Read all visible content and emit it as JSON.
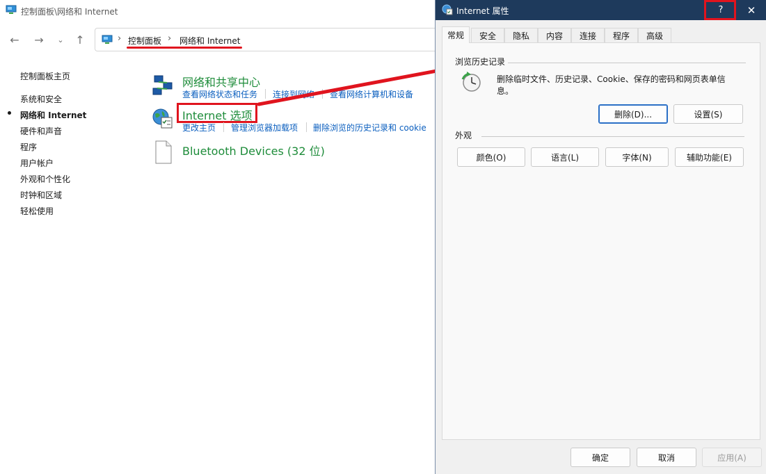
{
  "control_panel": {
    "window_title": "控制面板\\网络和 Internet",
    "breadcrumb": [
      "控制面板",
      "网络和 Internet"
    ],
    "sidebar": {
      "items": [
        {
          "label": "控制面板主页"
        },
        {
          "label": "系统和安全"
        },
        {
          "label": "网络和 Internet",
          "active": true
        },
        {
          "label": "硬件和声音"
        },
        {
          "label": "程序"
        },
        {
          "label": "用户帐户"
        },
        {
          "label": "外观和个性化"
        },
        {
          "label": "时钟和区域"
        },
        {
          "label": "轻松使用"
        }
      ]
    },
    "categories": [
      {
        "title": "网络和共享中心",
        "icon": "network-center-icon",
        "links": [
          "查看网络状态和任务",
          "连接到网络",
          "查看网络计算机和设备"
        ]
      },
      {
        "title": "Internet 选项",
        "icon": "internet-options-icon",
        "links": [
          "更改主页",
          "管理浏览器加载项",
          "删除浏览的历史记录和 cookie"
        ]
      },
      {
        "title": "Bluetooth Devices (32 位)",
        "icon": "blank-document-icon",
        "links": []
      }
    ]
  },
  "dialog": {
    "title": "Internet 属性",
    "help": "?",
    "close": "✕",
    "tabs": [
      "常规",
      "安全",
      "隐私",
      "内容",
      "连接",
      "程序",
      "高级"
    ],
    "active_tab": "常规",
    "history_group": {
      "label": "浏览历史记录",
      "description": "删除临时文件、历史记录、Cookie、保存的密码和网页表单信息。",
      "delete_button": "删除(D)...",
      "settings_button": "设置(S)"
    },
    "appearance_group": {
      "label": "外观",
      "buttons": [
        "颜色(O)",
        "语言(L)",
        "字体(N)",
        "辅助功能(E)"
      ]
    },
    "footer": {
      "ok": "确定",
      "cancel": "取消",
      "apply": "应用(A)"
    }
  },
  "colors": {
    "annotation_red": "#e0141e",
    "dialog_titlebar": "#1e3a5c",
    "category_green": "#1e8c3a",
    "link_blue": "#0b5fbf"
  }
}
